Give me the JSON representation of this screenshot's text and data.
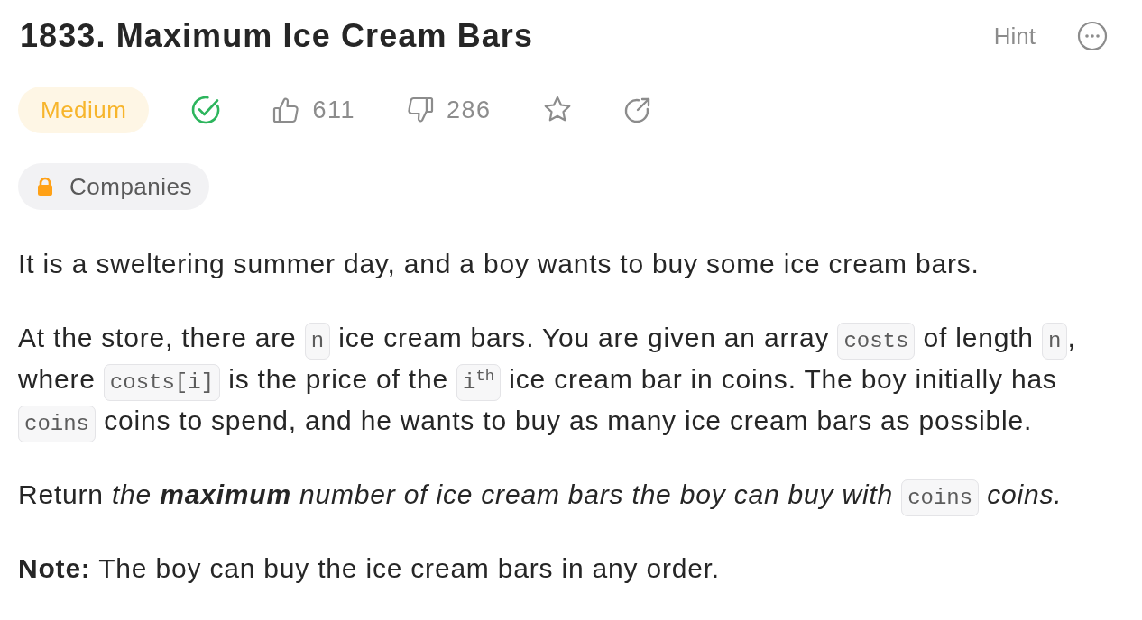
{
  "problem": {
    "title": "1833. Maximum Ice Cream Bars"
  },
  "actions": {
    "hint": "Hint"
  },
  "meta": {
    "difficulty": {
      "label": "Medium",
      "kind": "medium"
    },
    "solved": true,
    "likes": "611",
    "dislikes": "286",
    "favorite": false
  },
  "tags": [
    {
      "label": "Companies",
      "locked": true
    }
  ],
  "description": [
    {
      "segments": [
        {
          "kind": "text",
          "text": "It is a sweltering summer day, and a boy wants to buy some ice cream bars."
        }
      ]
    },
    {
      "segments": [
        {
          "kind": "text",
          "text": "At the store, there are "
        },
        {
          "kind": "code",
          "text": "n"
        },
        {
          "kind": "text",
          "text": " ice cream bars. You are given an array "
        },
        {
          "kind": "code",
          "text": "costs"
        },
        {
          "kind": "text",
          "text": " of length "
        },
        {
          "kind": "code",
          "text": "n"
        },
        {
          "kind": "text",
          "text": ", where "
        },
        {
          "kind": "code",
          "text": "costs[i]"
        },
        {
          "kind": "text",
          "text": " is the price of the "
        },
        {
          "kind": "code",
          "text": "i$^{th}$"
        },
        {
          "kind": "text",
          "text": " ice cream bar in coins. The boy initially has "
        },
        {
          "kind": "code",
          "text": "coins"
        },
        {
          "kind": "text",
          "text": " coins to spend, and he wants to buy as many ice cream bars as possible."
        }
      ]
    },
    {
      "segments": [
        {
          "kind": "text",
          "text": "Return "
        },
        {
          "kind": "em",
          "text": "the **maximum** number of ice cream bars the boy can buy with "
        },
        {
          "kind": "code",
          "text": "coins"
        },
        {
          "kind": "em",
          "text": " coins."
        }
      ]
    },
    {
      "segments": [
        {
          "kind": "text",
          "text": "**Note:** The boy can buy the ice cream bars in any order."
        }
      ]
    }
  ]
}
